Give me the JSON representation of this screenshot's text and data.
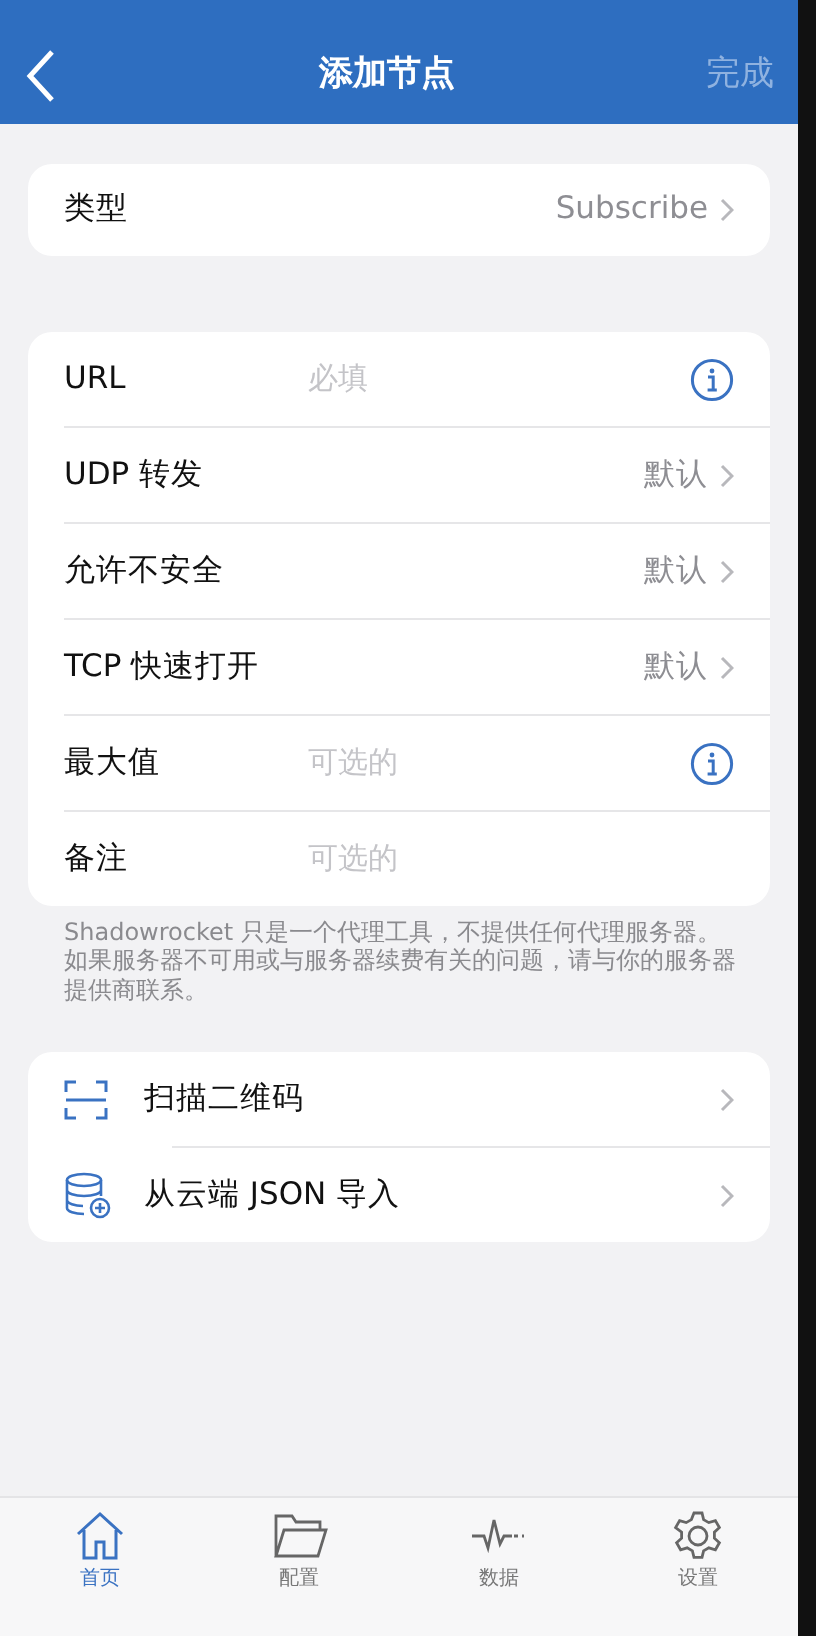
{
  "nav": {
    "title": "添加节点",
    "action": "完成"
  },
  "type_row": {
    "label": "类型",
    "value": "Subscribe"
  },
  "fields": [
    {
      "kind": "input",
      "label": "URL",
      "placeholder": "必填",
      "info": true
    },
    {
      "kind": "select",
      "label": "UDP 转发",
      "value": "默认"
    },
    {
      "kind": "select",
      "label": "允许不安全",
      "value": "默认"
    },
    {
      "kind": "select",
      "label": "TCP 快速打开",
      "value": "默认"
    },
    {
      "kind": "input",
      "label": "最大值",
      "placeholder": "可选的",
      "info": true
    },
    {
      "kind": "input",
      "label": "备注",
      "placeholder": "可选的",
      "info": false
    }
  ],
  "note": "Shadowrocket 只是一个代理工具，不提供任何代理服务器。如果服务器不可用或与服务器续费有关的问题，请与你的服务器提供商联系。",
  "actions": [
    {
      "kind": "scan",
      "label": "扫描二维码"
    },
    {
      "kind": "cloud",
      "label": "从云端 JSON 导入"
    }
  ],
  "tabs": [
    {
      "kind": "home",
      "label": "首页",
      "selected": true
    },
    {
      "kind": "config",
      "label": "配置",
      "selected": false
    },
    {
      "kind": "data",
      "label": "数据",
      "selected": false
    },
    {
      "kind": "settings",
      "label": "设置",
      "selected": false
    }
  ]
}
